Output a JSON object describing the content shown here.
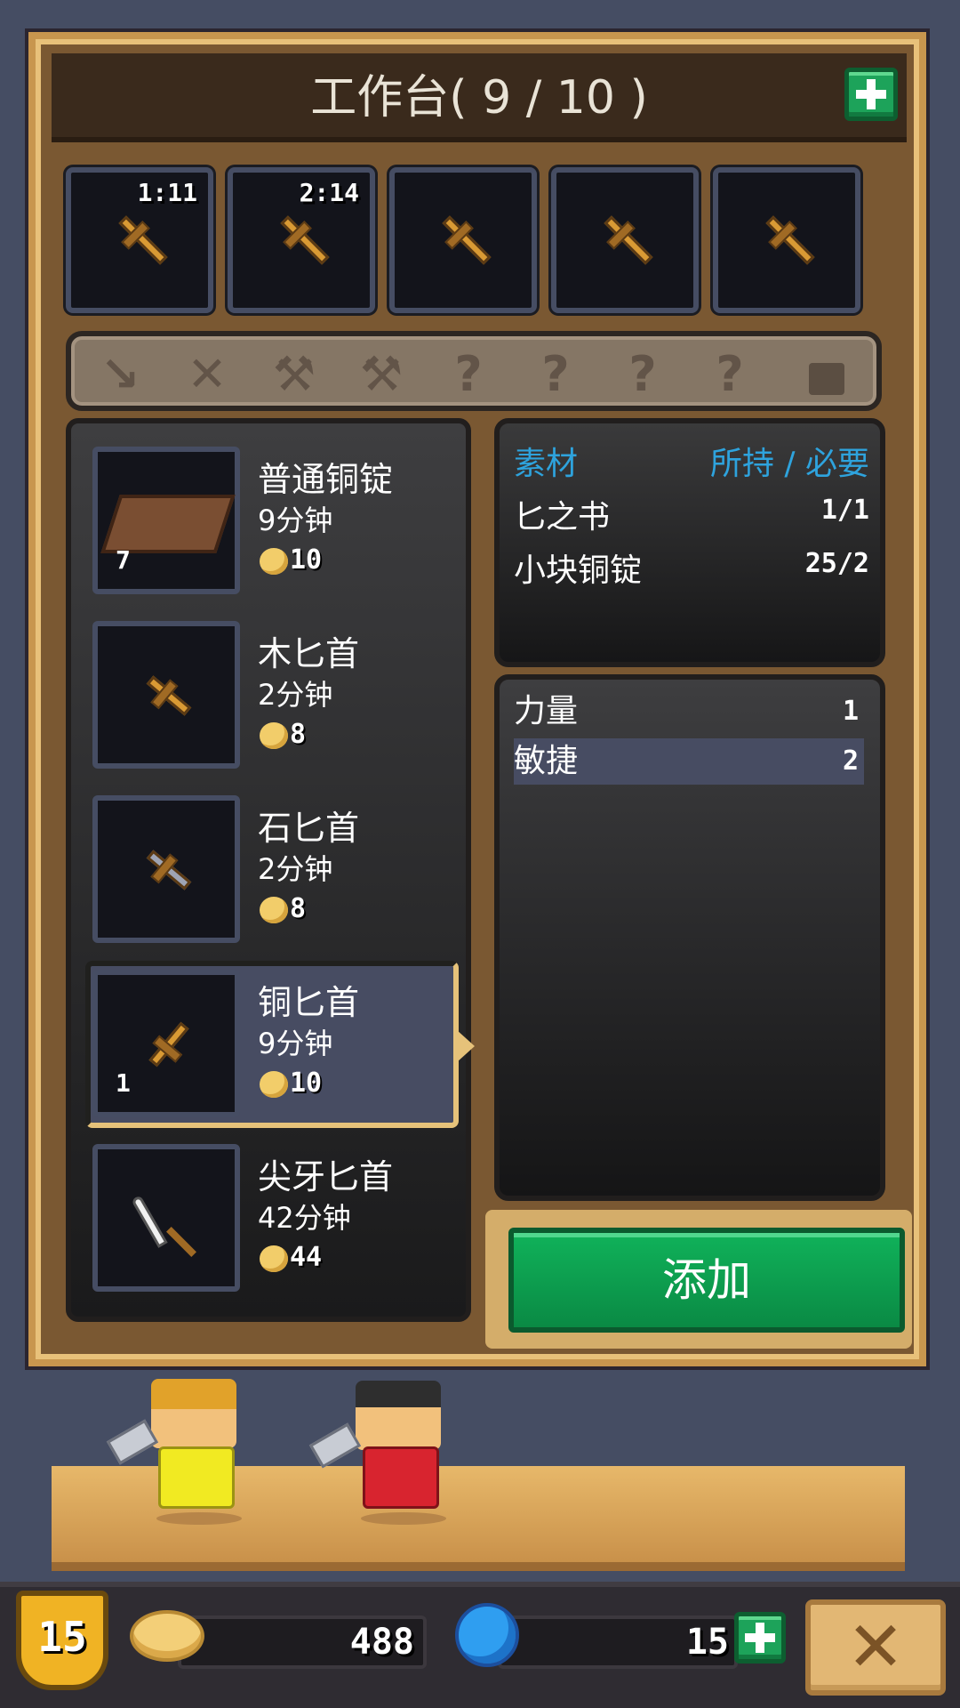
{
  "header": {
    "title": "工作台( 9 / 10 )"
  },
  "queue_slots": [
    {
      "timer": "1:11",
      "icon": "wood-dagger-icon"
    },
    {
      "timer": "2:14",
      "icon": "wood-dagger-icon"
    },
    {
      "timer": "",
      "icon": "wood-dagger-icon"
    },
    {
      "timer": "",
      "icon": "wood-dagger-icon"
    },
    {
      "timer": "",
      "icon": "wood-dagger-icon"
    }
  ],
  "categories": [
    {
      "icon": "dagger-category-icon",
      "glyph": "↘"
    },
    {
      "icon": "sword-category-icon",
      "glyph": "✕"
    },
    {
      "icon": "axe-category-icon",
      "glyph": "⚒"
    },
    {
      "icon": "hammer-category-icon",
      "glyph": "⚒"
    },
    {
      "icon": "locked-category-icon",
      "glyph": "?"
    },
    {
      "icon": "locked-category-icon",
      "glyph": "?"
    },
    {
      "icon": "locked-category-icon",
      "glyph": "?"
    },
    {
      "icon": "locked-category-icon",
      "glyph": "?"
    },
    {
      "icon": "lock-icon",
      "glyph": ""
    }
  ],
  "recipes": [
    {
      "name": "普通铜锭",
      "time": "9分钟",
      "cost": "10",
      "count": "7"
    },
    {
      "name": "木匕首",
      "time": "2分钟",
      "cost": "8",
      "count": ""
    },
    {
      "name": "石匕首",
      "time": "2分钟",
      "cost": "8",
      "count": ""
    },
    {
      "name": "铜匕首",
      "time": "9分钟",
      "cost": "10",
      "count": "1"
    },
    {
      "name": "尖牙匕首",
      "time": "42分钟",
      "cost": "44",
      "count": ""
    }
  ],
  "materials": {
    "header_left": "素材",
    "header_right": "所持 / 必要",
    "rows": [
      {
        "name": "匕之书",
        "value": "1/1"
      },
      {
        "name": "小块铜锭",
        "value": "25/2"
      }
    ]
  },
  "stats": [
    {
      "name": "力量",
      "value": "1"
    },
    {
      "name": "敏捷",
      "value": "2"
    }
  ],
  "add_button": "添加",
  "footer": {
    "level": "15",
    "gold": "488",
    "gems": "15"
  },
  "colors": {
    "accent_green": "#10b25a",
    "frame_gold": "#c8964e",
    "material_blue": "#2ea3dd"
  }
}
